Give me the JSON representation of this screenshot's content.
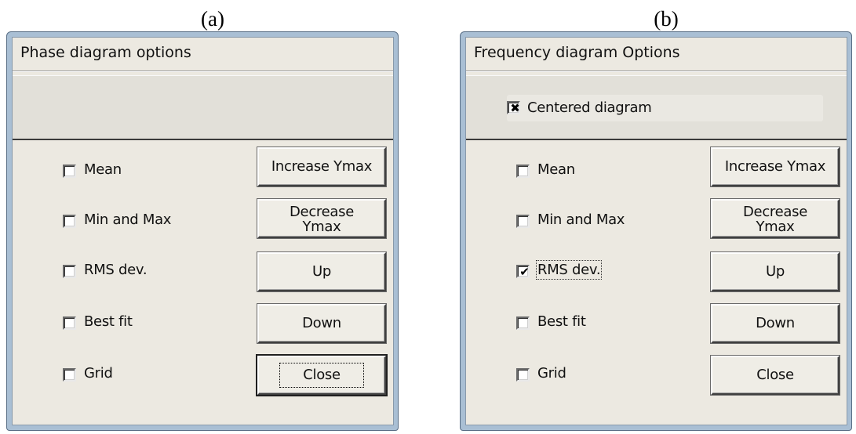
{
  "captions": {
    "a": "(a)",
    "b": "(b)"
  },
  "dialog_a": {
    "title": "Phase diagram options",
    "checkboxes": [
      {
        "label": "Mean",
        "checked": false
      },
      {
        "label": "Min and Max",
        "checked": false
      },
      {
        "label": "RMS dev.",
        "checked": false
      },
      {
        "label": "Best fit",
        "checked": false
      },
      {
        "label": "Grid",
        "checked": false
      }
    ],
    "buttons": {
      "increase_ymax": "Increase Ymax",
      "decrease_ymax_line1": "Decrease",
      "decrease_ymax_line2": "Ymax",
      "up": "Up",
      "down": "Down",
      "close": "Close"
    },
    "focused_button": "close"
  },
  "dialog_b": {
    "title": "Frequency diagram Options",
    "centered_diagram": {
      "label": "Centered diagram",
      "checked": true,
      "mark": "✖"
    },
    "checkboxes": [
      {
        "label": "Mean",
        "checked": false
      },
      {
        "label": "Min and Max",
        "checked": false
      },
      {
        "label": "RMS dev.",
        "checked": true,
        "mark": "✔"
      },
      {
        "label": "Best fit",
        "checked": false
      },
      {
        "label": "Grid",
        "checked": false
      }
    ],
    "buttons": {
      "increase_ymax": "Increase Ymax",
      "decrease_ymax_line1": "Decrease",
      "decrease_ymax_line2": "Ymax",
      "up": "Up",
      "down": "Down",
      "close": "Close"
    },
    "focused_checkbox": "RMS dev."
  },
  "colors": {
    "frame": "#a9bfd4",
    "face": "#ece9e1",
    "text": "#111111"
  }
}
